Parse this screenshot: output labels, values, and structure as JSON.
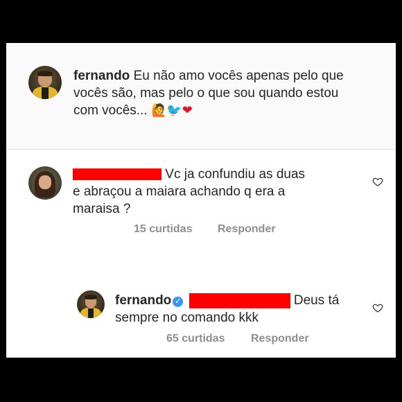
{
  "caption": {
    "username": "fernando",
    "line1": "Eu não amo vocês apenas pelo que",
    "line2": "vocês são, mas pelo o que sou quando estou",
    "line3": "com vocês...",
    "emojis": [
      "🙋",
      "🐦",
      "❤"
    ]
  },
  "comment1": {
    "line1": "Vc ja confundiu as duas",
    "line2": "e abraçou a maiara achando q era a",
    "line3": "maraisa ?",
    "likes": "15 curtidas",
    "reply": "Responder"
  },
  "reply1": {
    "username": "fernando",
    "line1_end": "Deus tá",
    "line2": "sempre no comando kkk",
    "likes": "65 curtidas",
    "reply": "Responder"
  },
  "colors": {
    "redaction": "#ff0000",
    "verified": "#3897f0",
    "meta_text": "#8e8e8e"
  },
  "icons": [
    "heart-outline-icon",
    "verified-badge-icon"
  ]
}
